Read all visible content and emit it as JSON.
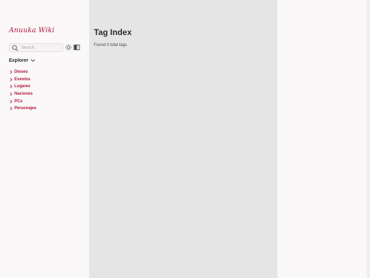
{
  "sidebar": {
    "site_title": "Anuuka Wiki",
    "search_placeholder": "Search",
    "explorer_label": "Explorer",
    "items": [
      {
        "label": "Dioses"
      },
      {
        "label": "Eventos"
      },
      {
        "label": "Lugares"
      },
      {
        "label": "Naciones"
      },
      {
        "label": "PCs"
      },
      {
        "label": "Personajes"
      }
    ]
  },
  "main": {
    "title": "Tag Index",
    "subtitle": "Found 0 total tags."
  },
  "colors": {
    "accent": "#b3123e",
    "main_bg": "#e5e5e5",
    "sidebar_bg": "#faf8f8"
  },
  "icons": {
    "search": "search-icon",
    "theme": "sun-icon",
    "reader": "book-icon",
    "chevron": "chevron-icon"
  }
}
